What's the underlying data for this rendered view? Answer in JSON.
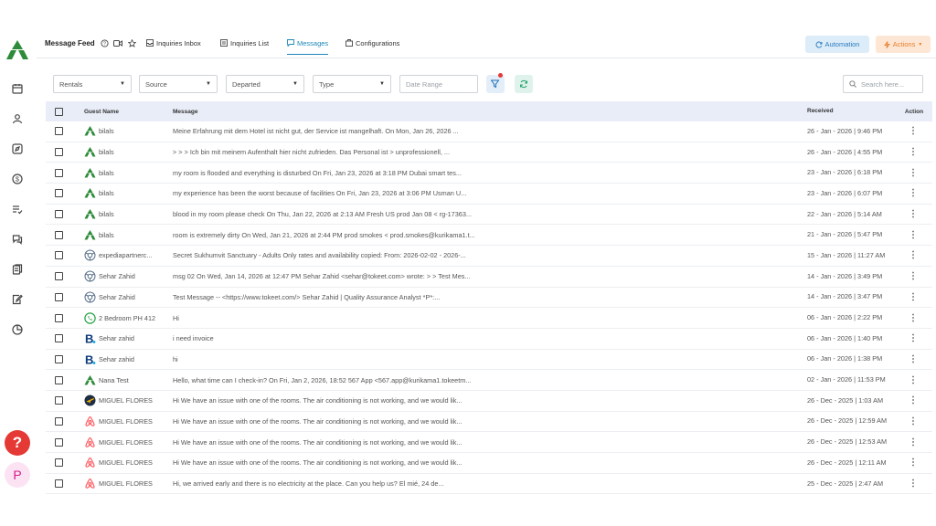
{
  "header": {
    "title": "Message Feed",
    "tabs": [
      {
        "label": "Inquiries Inbox",
        "icon": "inbox-icon"
      },
      {
        "label": "Inquiries List",
        "icon": "list-icon"
      },
      {
        "label": "Messages",
        "icon": "chat-icon",
        "active": true
      },
      {
        "label": "Configurations",
        "icon": "settings-icon"
      }
    ],
    "automation_label": "Automation",
    "actions_label": "Actions"
  },
  "filters": {
    "rentals": "Rentals",
    "source": "Source",
    "departed": "Departed",
    "type": "Type",
    "date_range_placeholder": "Date Range",
    "search_placeholder": "Search here..."
  },
  "table": {
    "columns": {
      "guest": "Guest Name",
      "message": "Message",
      "received": "Received",
      "action": "Action"
    },
    "rows": [
      {
        "channel": "tokeet",
        "guest": "bilals",
        "message": "Meine Erfahrung mit dem Hotel ist nicht gut, der Service ist mangelhaft. On Mon, Jan 26, 2026 ...",
        "received": "26 - Jan - 2026 | 9:46 PM"
      },
      {
        "channel": "tokeet",
        "guest": "bilals",
        "message": "> > > Ich bin mit meinem Aufenthalt hier nicht zufrieden. Das Personal ist > unprofessionell, ...",
        "received": "26 - Jan - 2026 | 4:55 PM"
      },
      {
        "channel": "tokeet",
        "guest": "bilals",
        "message": "my room is flooded and everything is disturbed On Fri, Jan 23, 2026 at 3:18 PM Dubai smart tes...",
        "received": "23 - Jan - 2026 | 6:18 PM"
      },
      {
        "channel": "tokeet",
        "guest": "bilals",
        "message": "my experience has been the worst because of facilities On Fri, Jan 23, 2026 at 3:06 PM Usman U...",
        "received": "23 - Jan - 2026 | 6:07 PM"
      },
      {
        "channel": "tokeet",
        "guest": "bilals",
        "message": "blood in my room please check On Thu, Jan 22, 2026 at 2:13 AM Fresh US prod Jan 08 < rg-17363...",
        "received": "22 - Jan - 2026 | 5:14 AM"
      },
      {
        "channel": "tokeet",
        "guest": "bilals",
        "message": "room is extremely dirty On Wed, Jan 21, 2026 at 2:44 PM prod smokes < prod.smokes@kurikama1.t...",
        "received": "21 - Jan - 2026 | 5:47 PM"
      },
      {
        "channel": "expedia",
        "guest": "expediapartnerc...",
        "message": "Secret Sukhumvit Sanctuary - Adults Only rates and availability copied: From: 2026-02-02 - 2026-...",
        "received": "15 - Jan - 2026 | 11:27 AM"
      },
      {
        "channel": "expedia",
        "guest": "Sehar Zahid",
        "message": "msg 02 On Wed, Jan 14, 2026 at 12:47 PM Sehar Zahid <sehar@tokeet.com> wrote: > > Test Mes...",
        "received": "14 - Jan - 2026 | 3:49 PM"
      },
      {
        "channel": "expedia",
        "guest": "Sehar Zahid",
        "message": "Test Message -- <https://www.tokeet.com/> Sehar Zahid | Quality Assurance Analyst *P*:...",
        "received": "14 - Jan - 2026 | 3:47 PM"
      },
      {
        "channel": "whatsapp",
        "guest": "2 Bedroom PH 412",
        "message": "Hi",
        "received": "06 - Jan - 2026 | 2:22 PM"
      },
      {
        "channel": "booking",
        "guest": "Sehar zahid",
        "message": "i need invoice",
        "received": "06 - Jan - 2026 | 1:40 PM"
      },
      {
        "channel": "booking",
        "guest": "Sehar zahid",
        "message": "hi",
        "received": "06 - Jan - 2026 | 1:38 PM"
      },
      {
        "channel": "tokeet",
        "guest": "Nana Test",
        "message": "Hello, what time can I check-in? On Fri, Jan 2, 2026, 18:52 567 App <567.app@kurikama1.tokeetm...",
        "received": "02 - Jan - 2026 | 11:53 PM"
      },
      {
        "channel": "plane",
        "guest": "MIGUEL FLORES",
        "message": "Hi We have an issue with one of the rooms. The air conditioning is not working, and we would lik...",
        "received": "26 - Dec - 2025 | 1:03 AM"
      },
      {
        "channel": "airbnb",
        "guest": "MIGUEL FLORES",
        "message": "Hi We have an issue with one of the rooms. The air conditioning is not working, and we would lik...",
        "received": "26 - Dec - 2025 | 12:59 AM"
      },
      {
        "channel": "airbnb",
        "guest": "MIGUEL FLORES",
        "message": "Hi We have an issue with one of the rooms. The air conditioning is not working, and we would lik...",
        "received": "26 - Dec - 2025 | 12:53 AM"
      },
      {
        "channel": "airbnb",
        "guest": "MIGUEL FLORES",
        "message": "Hi We have an issue with one of the rooms. The air conditioning is not working, and we would lik...",
        "received": "26 - Dec - 2025 | 12:11 AM"
      },
      {
        "channel": "airbnb",
        "guest": "MIGUEL FLORES",
        "message": "Hi, we arrived early and there is no electricity at the place. Can you help us? El mié, 24 de...",
        "received": "25 - Dec - 2025 | 2:47 AM"
      }
    ]
  },
  "sidebar": {
    "icons": [
      "calendar-icon",
      "users-icon",
      "compass-icon",
      "dollar-icon",
      "checklist-icon",
      "messages-icon",
      "documents-icon",
      "edit-icon",
      "pie-chart-icon"
    ],
    "help_label": "?",
    "avatar_initial": "P"
  },
  "colors": {
    "accent": "#1e88b8",
    "tokeet_green": "#2e8b3a",
    "airbnb": "#ff5a5f",
    "booking": "#0c3b7c",
    "help": "#e53935",
    "header_bg": "#e8edf8"
  }
}
